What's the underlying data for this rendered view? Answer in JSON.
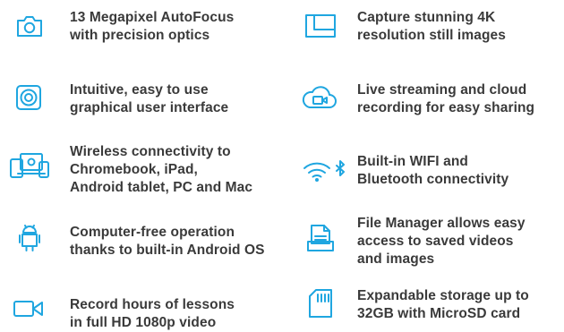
{
  "accent_color": "#1fa6e0",
  "text_color": "#3a3a3a",
  "features": [
    {
      "icon": "camera-icon",
      "lines": [
        "13 Megapixel AutoFocus",
        "with precision optics"
      ]
    },
    {
      "icon": "frame-icon",
      "lines": [
        "Capture stunning 4K",
        "resolution still images"
      ]
    },
    {
      "icon": "interface-icon",
      "lines": [
        "Intuitive, easy to use",
        "graphical user interface"
      ]
    },
    {
      "icon": "cloud-camera-icon",
      "lines": [
        "Live streaming and cloud",
        "recording for easy sharing"
      ]
    },
    {
      "icon": "devices-icon",
      "lines": [
        "Wireless connectivity to",
        "Chromebook, iPad,",
        "Android tablet, PC and Mac"
      ]
    },
    {
      "icon": "wifi-bluetooth-icon",
      "lines": [
        "Built-in WIFI and",
        "Bluetooth connectivity"
      ]
    },
    {
      "icon": "android-icon",
      "lines": [
        "Computer-free operation",
        "thanks to built-in Android OS"
      ]
    },
    {
      "icon": "file-manager-icon",
      "lines": [
        "File Manager allows easy",
        "access to saved videos",
        "and images"
      ]
    },
    {
      "icon": "video-camera-icon",
      "lines": [
        "Record hours of lessons",
        "in full HD 1080p video"
      ]
    },
    {
      "icon": "sd-card-icon",
      "lines": [
        "Expandable storage up to",
        "32GB with MicroSD card"
      ]
    }
  ]
}
